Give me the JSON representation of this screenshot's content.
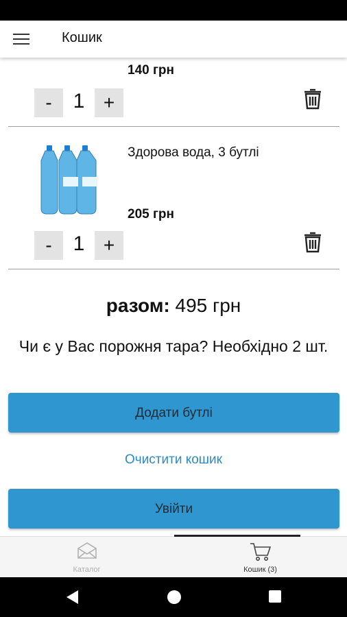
{
  "header": {
    "title": "Кошик"
  },
  "cart": {
    "items": [
      {
        "price": "140 грн",
        "quantity": "1"
      },
      {
        "name": "Здорова вода, 3 бутлі",
        "price": "205 грн",
        "quantity": "1"
      }
    ],
    "minus_label": "-",
    "plus_label": "+"
  },
  "summary": {
    "total_label": "разом:",
    "total_value": "495 грн",
    "note": "Чи є у Вас порожня тара? Необхідно 2 шт."
  },
  "actions": {
    "add_bottles": "Додати бутлі",
    "clear_cart": "Очистити кошик",
    "login": "Увійти"
  },
  "tabs": [
    {
      "label": "Каталог",
      "icon": "envelope-icon",
      "active": false
    },
    {
      "label": "Кошик (3)",
      "icon": "cart-icon",
      "active": true
    }
  ],
  "colors": {
    "accent": "#2f96cf",
    "link": "#2a8bc4",
    "bottle": "#5fb6e6"
  }
}
